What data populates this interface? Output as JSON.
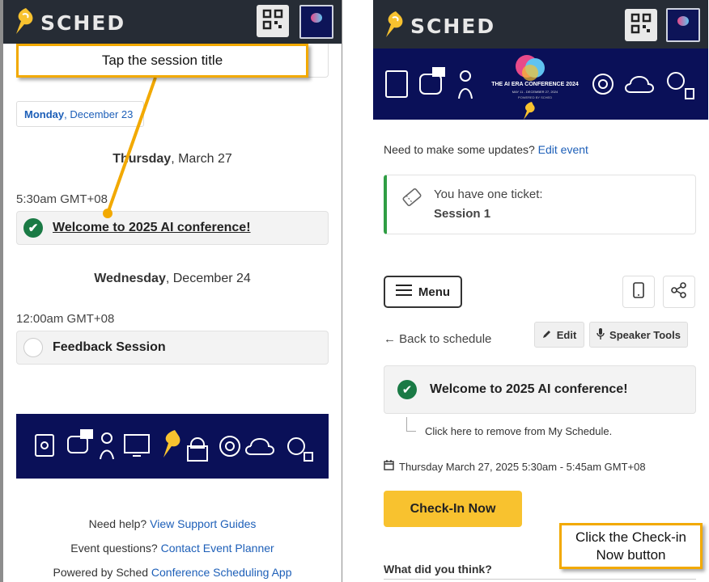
{
  "brand": {
    "name": "SCHED"
  },
  "left": {
    "callout": "Tap the session title",
    "date_tab": {
      "day": "Monday",
      "rest": ", December 23"
    },
    "days": [
      {
        "weekday": "Thursday",
        "rest": ", March 27",
        "time": "5:30am GMT+08",
        "session": "Welcome to 2025 AI conference!",
        "added": true
      },
      {
        "weekday": "Wednesday",
        "rest": ", December 24",
        "time": "12:00am GMT+08",
        "session": "Feedback Session",
        "added": false
      }
    ],
    "footer": {
      "help_prefix": "Need help? ",
      "help_link": "View Support Guides",
      "questions_prefix": "Event questions? ",
      "questions_link": "Contact Event Planner",
      "powered_prefix": "Powered by Sched ",
      "powered_link": "Conference Scheduling App"
    }
  },
  "right": {
    "banner": {
      "title": "THE AI ERA CONFERENCE 2024",
      "dates": "MAY 11 - DECEMBER 27, 2024",
      "tagline": "POWERED BY SCHED"
    },
    "updates_prefix": "Need to make some updates? ",
    "edit_event_link": "Edit event",
    "ticket": {
      "line1": "You have one ticket:",
      "line2": "Session 1"
    },
    "menu_label": "Menu",
    "back_link": "← Back to schedule",
    "edit_label": "Edit",
    "speaker_tools_label": "Speaker Tools",
    "session_title": "Welcome to 2025 AI conference!",
    "remove_text": "Click here to remove from My Schedule.",
    "datetime": "Thursday March 27, 2025 5:30am - 5:45am GMT+08",
    "checkin_label": "Check-In Now",
    "feedback_heading": "What did you think?",
    "callout": "Click the Check-in Now button"
  },
  "colors": {
    "accent": "#1d5fb8",
    "brand_bar": "#262c35",
    "callout_border": "#f2a900",
    "checkin": "#f8c22f",
    "check_green": "#1a7a45",
    "banner": "#0a1058"
  },
  "icons": [
    "sched-logo-icon",
    "qr-code-icon",
    "check-icon",
    "ticket-icon",
    "hamburger-icon",
    "mobile-icon",
    "share-icon",
    "pencil-icon",
    "microphone-icon",
    "calendar-icon"
  ]
}
